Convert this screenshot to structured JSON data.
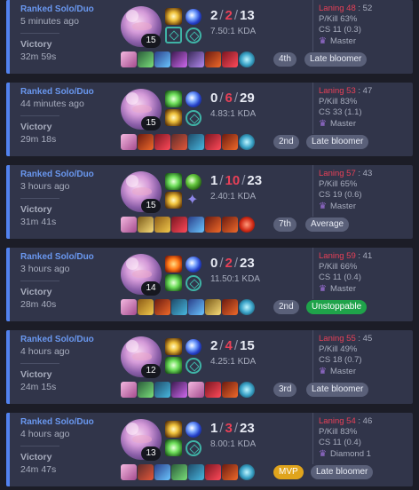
{
  "colors": {
    "accent": "#5282ee",
    "death": "#e84057",
    "unstoppable": "#1fa34a",
    "mvp": "#e0a41c"
  },
  "matches": [
    {
      "queue": "Ranked Solo/Duo",
      "ago": "5 minutes ago",
      "result": "Victory",
      "duration": "32m 59s",
      "level": "15",
      "kills": "2",
      "deaths": "2",
      "assists": "13",
      "kda": "7.50:1 KDA",
      "laning_label": "Laning 48",
      "laning_enemy": "52",
      "pkill": "P/Kill 63%",
      "cs": "CS 11 (0.3)",
      "tier": "Master",
      "rank": "4th",
      "tag": "Late bloomer",
      "tag_style": "grey",
      "spells": [
        "flash",
        "flash-teal"
      ],
      "runes": [
        "r-blue",
        "r-teal"
      ],
      "items": [
        "i1",
        "i2",
        "i3",
        "i4",
        "i5",
        "i6",
        "i7"
      ],
      "trinket": "trinket-teal"
    },
    {
      "queue": "Ranked Solo/Duo",
      "ago": "44 minutes ago",
      "result": "Victory",
      "duration": "29m 18s",
      "level": "15",
      "kills": "0",
      "deaths": "6",
      "assists": "29",
      "kda": "4.83:1 KDA",
      "laning_label": "Laning 53",
      "laning_enemy": "47",
      "pkill": "P/Kill 83%",
      "cs": "CS 33 (1.1)",
      "tier": "Master",
      "rank": "2nd",
      "tag": "Late bloomer",
      "tag_style": "grey",
      "spells": [
        "heal",
        "flash"
      ],
      "runes": [
        "r-blue",
        "r-teal"
      ],
      "items": [
        "i1",
        "i7",
        "i8",
        "i2",
        "i10",
        "i8",
        "i7"
      ],
      "trinket": "trinket-teal"
    },
    {
      "queue": "Ranked Solo/Duo",
      "ago": "3 hours ago",
      "result": "Victory",
      "duration": "31m 41s",
      "level": "15",
      "kills": "1",
      "deaths": "10",
      "assists": "23",
      "kda": "2.40:1 KDA",
      "laning_label": "Laning 57",
      "laning_enemy": "43",
      "pkill": "P/Kill 65%",
      "cs": "CS 19 (0.6)",
      "tier": "Master",
      "rank": "7th",
      "tag": "Average",
      "tag_style": "grey",
      "spells": [
        "heal",
        "flash"
      ],
      "runes": [
        "r-green",
        "r-purple"
      ],
      "items": [
        "i1",
        "i11",
        "i6",
        "i8",
        "i3",
        "i7",
        "i7"
      ],
      "trinket": "trinket-red"
    },
    {
      "queue": "Ranked Solo/Duo",
      "ago": "3 hours ago",
      "result": "Victory",
      "duration": "28m 40s",
      "level": "14",
      "kills": "0",
      "deaths": "2",
      "assists": "23",
      "kda": "11.50:1 KDA",
      "laning_label": "Laning 59",
      "laning_enemy": "41",
      "pkill": "P/Kill 66%",
      "cs": "CS 11 (0.4)",
      "tier": "Master",
      "rank": "2nd",
      "tag": "Unstoppable",
      "tag_style": "green",
      "spells": [
        "ignite",
        "heal"
      ],
      "runes": [
        "r-blue",
        "r-teal"
      ],
      "items": [
        "i1",
        "i6",
        "i7",
        "i10",
        "i3",
        "i11",
        "i7"
      ],
      "trinket": "trinket-teal"
    },
    {
      "queue": "Ranked Solo/Duo",
      "ago": "4 hours ago",
      "result": "Victory",
      "duration": "24m 15s",
      "level": "12",
      "kills": "2",
      "deaths": "4",
      "assists": "15",
      "kda": "4.25:1 KDA",
      "laning_label": "Laning 55",
      "laning_enemy": "45",
      "pkill": "P/Kill 49%",
      "cs": "CS 18 (0.7)",
      "tier": "Master",
      "rank": "3rd",
      "tag": "Late bloomer",
      "tag_style": "grey",
      "spells": [
        "flash",
        "heal"
      ],
      "runes": [
        "r-blue",
        "r-teal"
      ],
      "items": [
        "i1",
        "i5",
        "i10",
        "i4",
        "i1",
        "i8",
        "i7"
      ],
      "trinket": "trinket-teal"
    },
    {
      "queue": "Ranked Solo/Duo",
      "ago": "4 hours ago",
      "result": "Victory",
      "duration": "24m 47s",
      "level": "13",
      "kills": "1",
      "deaths": "3",
      "assists": "23",
      "kda": "8.00:1 KDA",
      "laning_label": "Laning 54",
      "laning_enemy": "46",
      "pkill": "P/Kill 83%",
      "cs": "CS 11 (0.4)",
      "tier": "Diamond 1",
      "rank": "MVP",
      "tag": "Late bloomer",
      "tag_style": "grey",
      "spells": [
        "flash",
        "heal"
      ],
      "runes": [
        "r-blue",
        "r-teal"
      ],
      "items": [
        "i1",
        "i2",
        "i3",
        "i5",
        "i10",
        "i8",
        "i7"
      ],
      "trinket": "trinket-teal"
    }
  ]
}
